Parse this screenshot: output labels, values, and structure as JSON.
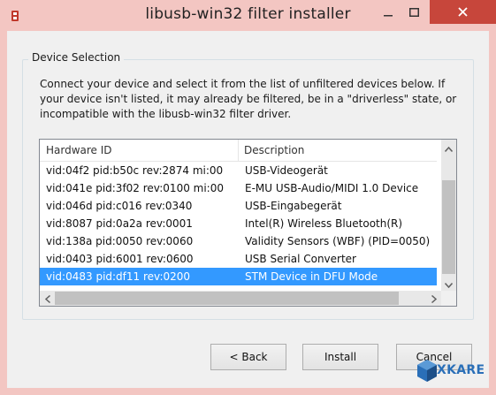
{
  "window": {
    "title": "libusb-win32 filter installer"
  },
  "group": {
    "legend": "Device Selection"
  },
  "instructions": "Connect your device and select it from the list of unfiltered devices below. If your device isn't listed, it may already be filtered, be in a \"driverless\" state, or incompatible with the libusb-win32 filter driver.",
  "devices": {
    "columns": [
      "Hardware ID",
      "Description"
    ],
    "rows": [
      {
        "hwid": "vid:04f2 pid:b50c rev:2874 mi:00",
        "desc": "USB-Videogerät"
      },
      {
        "hwid": "vid:041e pid:3f02 rev:0100 mi:00",
        "desc": "E-MU USB-Audio/MIDI 1.0 Device"
      },
      {
        "hwid": "vid:046d pid:c016 rev:0340",
        "desc": "USB-Eingabegerät"
      },
      {
        "hwid": "vid:8087 pid:0a2a rev:0001",
        "desc": "Intel(R) Wireless Bluetooth(R)"
      },
      {
        "hwid": "vid:138a pid:0050 rev:0060",
        "desc": "Validity Sensors (WBF) (PID=0050)"
      },
      {
        "hwid": "vid:0403 pid:6001 rev:0600",
        "desc": "USB Serial Converter"
      },
      {
        "hwid": "vid:0483 pid:df11 rev:0200",
        "desc": "STM Device in DFU Mode"
      }
    ],
    "selected_index": 6
  },
  "buttons": {
    "back": "< Back",
    "install": "Install",
    "cancel": "Cancel"
  },
  "watermark": {
    "text": "XKARE"
  },
  "icons": {
    "app": "usb-app-icon",
    "minimize": "minimize-icon",
    "maximize": "maximize-icon",
    "close": "close-icon"
  },
  "colors": {
    "titlebar": "#f3c6c2",
    "close_button": "#c7463b",
    "selection": "#3399ff",
    "client_bg": "#f0f0f0"
  }
}
